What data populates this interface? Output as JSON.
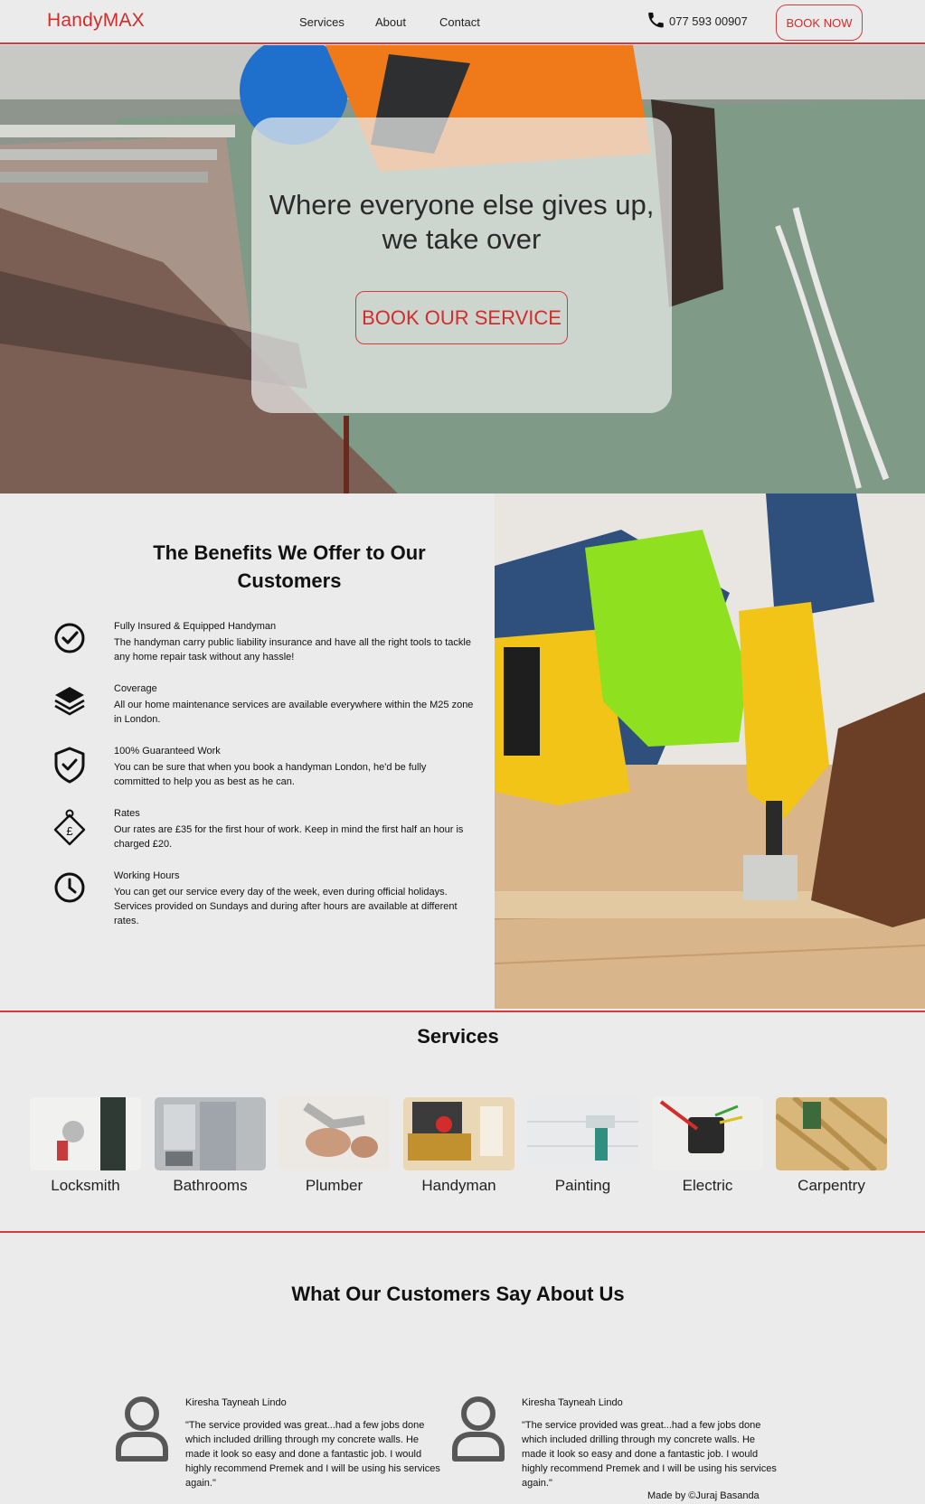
{
  "nav": {
    "logo": "HandyMAX",
    "links": [
      "Services",
      "About",
      "Contact"
    ],
    "phone": "077 593 00907",
    "book_now": "BOOK NOW"
  },
  "hero": {
    "title": "Where everyone else gives up,",
    "subtitle": "we take over",
    "cta": "BOOK OUR SERVICE"
  },
  "benefits": {
    "title": "The Benefits We Offer to Our Customers",
    "items": [
      {
        "icon": "check-circle-icon",
        "heading": "Fully Insured & Equipped Handyman",
        "text": "The handyman carry public liability insurance and have all the right tools to tackle any home repair task without any hassle!"
      },
      {
        "icon": "layers-icon",
        "heading": "Coverage",
        "text": "All our home maintenance services are available everywhere within the M25 zone in London."
      },
      {
        "icon": "shield-check-icon",
        "heading": "100% Guaranteed Work",
        "text": "You can be sure that when you book a handyman London, he'd be fully committed to help you as best as he can."
      },
      {
        "icon": "price-tag-icon",
        "heading": "Rates",
        "text": "Our rates are £35 for the first hour of work. Keep in mind the first half an hour is charged £20."
      },
      {
        "icon": "clock-icon",
        "heading": "Working Hours",
        "text": "You can get our service every day of the week, even during official holidays. Services provided on Sundays and during after hours are available at different rates."
      }
    ]
  },
  "services": {
    "title": "Services",
    "items": [
      "Locksmith",
      "Bathrooms",
      "Plumber",
      "Handyman",
      "Painting",
      "Electric",
      "Carpentry"
    ]
  },
  "testimonials": {
    "title": "What Our Customers Say About Us",
    "items": [
      {
        "name": "Kiresha Tayneah Lindo",
        "text": "\"The service provided was great...had a few jobs done which included drilling through my concrete walls. He made it look so easy and done a fantastic job. I would highly recommend Premek and I will be using his services again.\""
      },
      {
        "name": "Kiresha Tayneah Lindo",
        "text": "\"The service provided was great...had a few jobs done which included drilling through my concrete walls. He made it look so easy and done a fantastic job. I would highly recommend Premek and I will be using his services again.\""
      }
    ]
  },
  "footer": {
    "credit": "Made by ©Juraj Basanda"
  },
  "colors": {
    "accent": "#d42b2b",
    "background": "#ebebeb"
  }
}
